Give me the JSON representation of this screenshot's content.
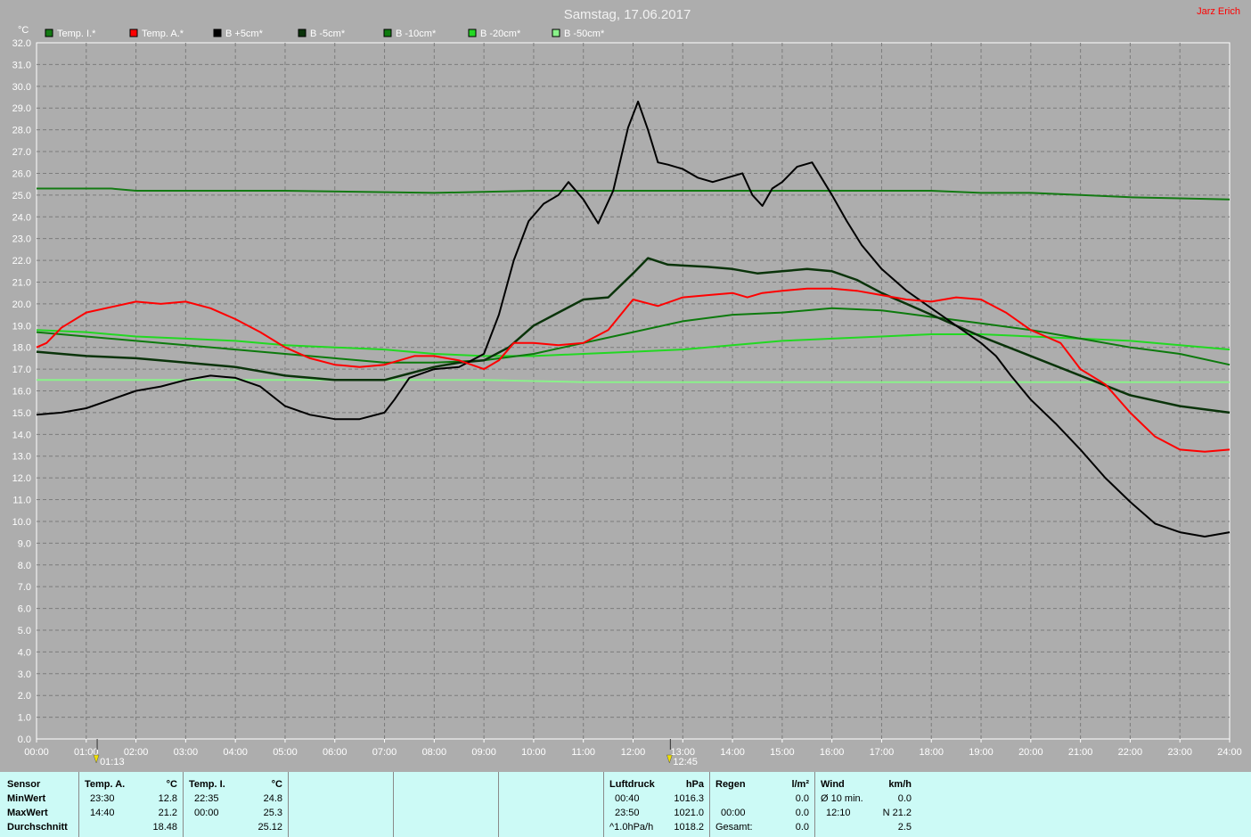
{
  "title": "Samstag, 17.06.2017",
  "author": "Jarz Erich",
  "colors": {
    "background": "#adadad",
    "plot": "#adadad",
    "grid": "#7c7c7c",
    "stats_bg": "#ccfaf6"
  },
  "chart_data": {
    "type": "line",
    "title": "Samstag, 17.06.2017",
    "ylabel": "°C",
    "xlabel": "",
    "xlim": [
      0,
      24
    ],
    "ylim": [
      0,
      32
    ],
    "x_ticks": [
      "00:00",
      "01:00",
      "02:00",
      "03:00",
      "04:00",
      "05:00",
      "06:00",
      "07:00",
      "08:00",
      "09:00",
      "10:00",
      "11:00",
      "12:00",
      "13:00",
      "14:00",
      "15:00",
      "16:00",
      "17:00",
      "18:00",
      "19:00",
      "20:00",
      "21:00",
      "22:00",
      "23:00",
      "24:00"
    ],
    "y_ticks": [
      "0.0",
      "1.0",
      "2.0",
      "3.0",
      "4.0",
      "5.0",
      "6.0",
      "7.0",
      "8.0",
      "9.0",
      "10.0",
      "11.0",
      "12.0",
      "13.0",
      "14.0",
      "15.0",
      "16.0",
      "17.0",
      "18.0",
      "19.0",
      "20.0",
      "21.0",
      "22.0",
      "23.0",
      "24.0",
      "25.0",
      "26.0",
      "27.0",
      "28.0",
      "29.0",
      "30.0",
      "31.0",
      "32.0"
    ],
    "grid": true,
    "legend_position": "top-left",
    "markers": [
      {
        "time": 1.22,
        "label": "01:13"
      },
      {
        "time": 12.75,
        "label": "12:45"
      }
    ],
    "series": [
      {
        "name": "Temp. I.*",
        "color": "#137a13",
        "x": [
          0,
          1.5,
          2,
          5,
          8,
          10,
          14,
          16,
          18,
          19,
          20,
          21,
          22,
          23,
          24
        ],
        "y": [
          25.3,
          25.3,
          25.2,
          25.2,
          25.1,
          25.2,
          25.2,
          25.2,
          25.2,
          25.1,
          25.1,
          25.0,
          24.9,
          24.85,
          24.8
        ]
      },
      {
        "name": "Temp. A.*",
        "color": "#ff0000",
        "x": [
          0,
          0.2,
          0.5,
          1,
          2,
          2.5,
          3,
          3.5,
          4,
          4.5,
          5,
          5.5,
          6,
          6.5,
          7,
          7.3,
          7.6,
          8,
          8.5,
          9,
          9.3,
          9.6,
          10,
          10.5,
          11,
          11.5,
          12,
          12.5,
          13,
          13.5,
          14,
          14.3,
          14.6,
          15,
          15.5,
          16,
          16.5,
          17,
          17.5,
          18,
          18.5,
          19,
          19.5,
          20,
          20.3,
          20.6,
          21,
          21.5,
          22,
          22.5,
          23,
          23.5,
          24
        ],
        "y": [
          18.0,
          18.2,
          18.9,
          19.6,
          20.1,
          20.0,
          20.1,
          19.8,
          19.3,
          18.7,
          18.0,
          17.5,
          17.2,
          17.1,
          17.2,
          17.4,
          17.6,
          17.6,
          17.4,
          17.0,
          17.4,
          18.2,
          18.2,
          18.1,
          18.2,
          18.8,
          20.2,
          19.9,
          20.3,
          20.4,
          20.5,
          20.3,
          20.5,
          20.6,
          20.7,
          20.7,
          20.6,
          20.4,
          20.2,
          20.1,
          20.3,
          20.2,
          19.6,
          18.8,
          18.5,
          18.2,
          17.0,
          16.3,
          15.0,
          13.9,
          13.3,
          13.2,
          13.3
        ]
      },
      {
        "name": "B +5cm*",
        "color": "#000000",
        "x": [
          0,
          0.5,
          1,
          1.5,
          2,
          2.5,
          3,
          3.5,
          4,
          4.5,
          5,
          5.5,
          6,
          6.5,
          7,
          7.2,
          7.5,
          8,
          8.5,
          9,
          9.3,
          9.6,
          9.9,
          10.2,
          10.5,
          10.7,
          11,
          11.3,
          11.6,
          11.9,
          12.1,
          12.3,
          12.5,
          12.7,
          13,
          13.3,
          13.6,
          13.9,
          14.2,
          14.4,
          14.6,
          14.8,
          15,
          15.3,
          15.6,
          16,
          16.3,
          16.6,
          17,
          17.5,
          18,
          18.5,
          19,
          19.3,
          19.6,
          20,
          20.5,
          21,
          21.5,
          22,
          22.5,
          23,
          23.5,
          24
        ],
        "y": [
          14.9,
          15.0,
          15.2,
          15.6,
          16.0,
          16.2,
          16.5,
          16.7,
          16.6,
          16.2,
          15.3,
          14.9,
          14.7,
          14.7,
          15.0,
          15.6,
          16.6,
          17.0,
          17.1,
          17.7,
          19.5,
          22.0,
          23.8,
          24.6,
          25.0,
          25.6,
          24.8,
          23.7,
          25.2,
          28.1,
          29.3,
          28.0,
          26.5,
          26.4,
          26.2,
          25.8,
          25.6,
          25.8,
          26.0,
          25.0,
          24.5,
          25.3,
          25.6,
          26.3,
          26.5,
          25.0,
          23.8,
          22.7,
          21.6,
          20.6,
          19.8,
          19.0,
          18.2,
          17.6,
          16.7,
          15.6,
          14.5,
          13.3,
          12.0,
          10.9,
          9.9,
          9.5,
          9.3,
          9.5
        ]
      },
      {
        "name": "B -5cm*",
        "color": "#0a330a",
        "x": [
          0,
          1,
          2,
          3,
          4,
          5,
          6,
          7,
          7.5,
          8,
          8.5,
          9,
          9.5,
          10,
          10.5,
          11,
          11.5,
          12,
          12.3,
          12.7,
          13.5,
          14,
          14.5,
          15,
          15.5,
          16,
          16.5,
          17,
          18,
          19,
          20,
          21,
          22,
          23,
          24
        ],
        "y": [
          17.8,
          17.6,
          17.5,
          17.3,
          17.1,
          16.7,
          16.5,
          16.5,
          16.8,
          17.1,
          17.3,
          17.4,
          18.0,
          19.0,
          19.6,
          20.2,
          20.3,
          21.4,
          22.1,
          21.8,
          21.7,
          21.6,
          21.4,
          21.5,
          21.6,
          21.5,
          21.1,
          20.5,
          19.5,
          18.5,
          17.6,
          16.7,
          15.8,
          15.3,
          15.0
        ]
      },
      {
        "name": "B -10cm*",
        "color": "#0d7a0d",
        "x": [
          0,
          1,
          2,
          3,
          4,
          5,
          6,
          7,
          8,
          9,
          10,
          11,
          12,
          13,
          14,
          15,
          16,
          17,
          18,
          19,
          20,
          21,
          22,
          23,
          24
        ],
        "y": [
          18.7,
          18.5,
          18.3,
          18.1,
          17.9,
          17.7,
          17.5,
          17.3,
          17.3,
          17.4,
          17.7,
          18.2,
          18.7,
          19.2,
          19.5,
          19.6,
          19.8,
          19.7,
          19.4,
          19.1,
          18.8,
          18.4,
          18.0,
          17.7,
          17.2
        ]
      },
      {
        "name": "B -20cm*",
        "color": "#22d822",
        "x": [
          0,
          1,
          2,
          3,
          4,
          5,
          6,
          7,
          8,
          9,
          10,
          11,
          12,
          13,
          14,
          15,
          16,
          17,
          18,
          19,
          20,
          21,
          22,
          23,
          24
        ],
        "y": [
          18.8,
          18.7,
          18.5,
          18.4,
          18.3,
          18.1,
          18.0,
          17.9,
          17.7,
          17.6,
          17.6,
          17.7,
          17.8,
          17.9,
          18.1,
          18.3,
          18.4,
          18.5,
          18.6,
          18.6,
          18.5,
          18.4,
          18.3,
          18.1,
          17.9
        ]
      },
      {
        "name": "B -50cm*",
        "color": "#8af28a",
        "x": [
          0,
          5,
          9,
          10,
          11,
          15,
          20,
          24
        ],
        "y": [
          16.5,
          16.5,
          16.5,
          16.45,
          16.4,
          16.4,
          16.4,
          16.4
        ]
      }
    ]
  },
  "stats": {
    "sensor": {
      "header": "Sensor",
      "rows": [
        "MinWert",
        "MaxWert",
        "Durchschnitt"
      ]
    },
    "temp_a": {
      "header": "Temp. A.",
      "unit": "°C",
      "min_time": "23:30",
      "min_val": "12.8",
      "max_time": "14:40",
      "max_val": "21.2",
      "avg_val": "18.48"
    },
    "temp_i": {
      "header": "Temp. I.",
      "unit": "°C",
      "min_time": "22:35",
      "min_val": "24.8",
      "max_time": "00:00",
      "max_val": "25.3",
      "avg_val": "25.12"
    },
    "pressure": {
      "header": "Luftdruck",
      "unit": "hPa",
      "min_time": "00:40",
      "min_val": "1016.3",
      "max_time": "23:50",
      "max_val": "1021.0",
      "trend_label": "^1.0hPa/h",
      "trend_val": "1018.2"
    },
    "rain": {
      "header": "Regen",
      "unit": "l/m²",
      "min_val": "0.0",
      "max_time": "00:00",
      "max_val": "0.0",
      "total_label": "Gesamt:",
      "total_val": "0.0"
    },
    "wind": {
      "header": "Wind",
      "unit": "km/h",
      "min_label": "Ø 10 min.",
      "min_val": "0.0",
      "max_time": "12:10",
      "max_val": "N 21.2",
      "avg_val": "2.5"
    }
  }
}
